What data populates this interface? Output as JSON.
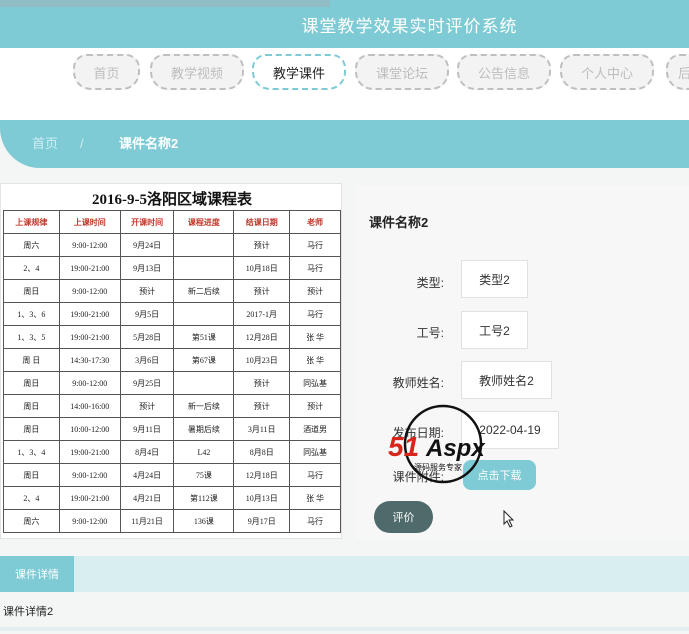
{
  "header": {
    "title": "课堂教学效果实时评价系统"
  },
  "nav": {
    "items": [
      {
        "label": "首页",
        "active": false
      },
      {
        "label": "教学视频",
        "active": false
      },
      {
        "label": "教学课件",
        "active": true
      },
      {
        "label": "课堂论坛",
        "active": false
      },
      {
        "label": "公告信息",
        "active": false
      },
      {
        "label": "个人中心",
        "active": false
      },
      {
        "label": "后",
        "active": false
      }
    ]
  },
  "breadcrumb": {
    "home": "首页",
    "separator": "/",
    "current": "课件名称2"
  },
  "schedule_image": {
    "title": "2016-9-5洛阳区域课程表",
    "headers": [
      "上课规律",
      "上课时间",
      "开课时间",
      "课程进度",
      "结课日期",
      "老师"
    ],
    "rows": [
      [
        "周六",
        "9:00-12:00",
        "9月24日",
        "",
        "预计",
        "马行"
      ],
      [
        "2、4",
        "19:00-21:00",
        "9月13日",
        "",
        "10月18日",
        "马行"
      ],
      [
        "周日",
        "9:00-12:00",
        "预计",
        "新二后续",
        "预计",
        "预计"
      ],
      [
        "1、3、6",
        "19:00-21:00",
        "9月5日",
        "",
        "2017-1月",
        "马行"
      ],
      [
        "1、3、5",
        "19:00-21:00",
        "5月28日",
        "第51课",
        "12月28日",
        "张 华"
      ],
      [
        "周 日",
        "14:30-17:30",
        "3月6日",
        "第67课",
        "10月23日",
        "张 华"
      ],
      [
        "周日",
        "9:00-12:00",
        "9月25日",
        "",
        "预计",
        "同弘基"
      ],
      [
        "周日",
        "14:00-16:00",
        "预计",
        "新一后续",
        "预计",
        "预计"
      ],
      [
        "周日",
        "10:00-12:00",
        "9月11日",
        "暑期后续",
        "3月11日",
        "酒道男"
      ],
      [
        "1、3、4",
        "19:00-21:00",
        "8月4日",
        "L42",
        "8月8日",
        "同弘基"
      ],
      [
        "周日",
        "9:00-12:00",
        "4月24日",
        "75课",
        "12月18日",
        "马行"
      ],
      [
        "2、4",
        "19:00-21:00",
        "4月21日",
        "第112课",
        "10月13日",
        "张 华"
      ],
      [
        "周六",
        "9:00-12:00",
        "11月21日",
        "136课",
        "9月17日",
        "马行"
      ]
    ]
  },
  "detail": {
    "title": "课件名称2",
    "type_label": "类型:",
    "type_value": "类型2",
    "id_label": "工号:",
    "id_value": "工号2",
    "teacher_label": "教师姓名:",
    "teacher_value": "教师姓名2",
    "date_label": "发布日期:",
    "date_value": "2022-04-19",
    "attach_label": "课件附件:",
    "download_label": "点击下载",
    "review_label": "评价"
  },
  "tabs": {
    "detail_tab": "课件详情"
  },
  "detail_text": "课件详情2",
  "watermark": {
    "brand": "51Aspx",
    "tagline": "源码服务专家"
  },
  "colors": {
    "accent": "#7ecad5",
    "dark_button": "#4f6a6b",
    "table_header": "#c0392b"
  }
}
